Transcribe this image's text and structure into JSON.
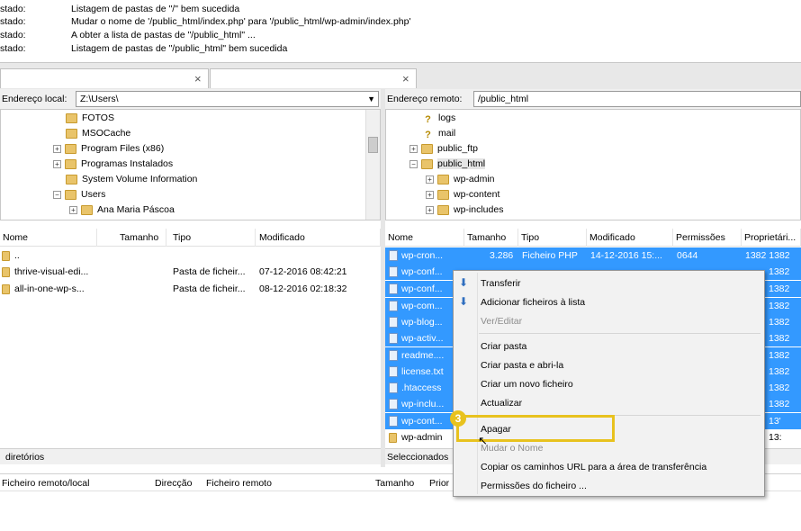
{
  "log": [
    {
      "label": "stado:",
      "message": "Listagem de pastas de \"/\" bem sucedida"
    },
    {
      "label": "stado:",
      "message": "Mudar o nome de '/public_html/index.php' para '/public_html/wp-admin/index.php'"
    },
    {
      "label": "stado:",
      "message": "A obter a lista de pastas de \"/public_html\" ..."
    },
    {
      "label": "stado:",
      "message": "Listagem de pastas de \"/public_html\" bem sucedida"
    }
  ],
  "tabs": {
    "close1": "×",
    "close2": "×"
  },
  "local": {
    "path_label": "Endereço local:",
    "path_value": "Z:\\Users\\",
    "tree": [
      "FOTOS",
      "MSOCache",
      "Program Files (x86)",
      "Programas Instalados",
      "System Volume Information",
      "Users",
      "Ana Maria Páscoa"
    ],
    "columns": [
      "Nome",
      "Tamanho",
      "Tipo",
      "Modificado"
    ],
    "files": [
      {
        "name": "..",
        "size": "",
        "type": "",
        "modified": ""
      },
      {
        "name": "thrive-visual-edi...",
        "size": "",
        "type": "Pasta de ficheir...",
        "modified": "07-12-2016 08:42:21"
      },
      {
        "name": "all-in-one-wp-s...",
        "size": "",
        "type": "Pasta de ficheir...",
        "modified": "08-12-2016 02:18:32"
      }
    ],
    "status": "diretórios"
  },
  "remote": {
    "path_label": "Endereço remoto:",
    "path_value": "/public_html",
    "tree": [
      "logs",
      "mail",
      "public_ftp",
      "public_html",
      "wp-admin",
      "wp-content",
      "wp-includes"
    ],
    "columns": [
      "Nome",
      "Tamanho",
      "Tipo",
      "Modificado",
      "Permissões",
      "Proprietári..."
    ],
    "files": [
      {
        "name": "wp-cron...",
        "size": "3.286",
        "type": "Ficheiro PHP",
        "modified": "14-12-2016 15:...",
        "perm": "0644",
        "owner": "1382 1382"
      },
      {
        "name": "wp-conf...",
        "size": "",
        "type": "",
        "modified": "",
        "perm": "",
        "owner": "1382"
      },
      {
        "name": "wp-conf...",
        "size": "",
        "type": "",
        "modified": "",
        "perm": "",
        "owner": "1382"
      },
      {
        "name": "wp-com...",
        "size": "",
        "type": "",
        "modified": "",
        "perm": "",
        "owner": "1382"
      },
      {
        "name": "wp-blog...",
        "size": "",
        "type": "",
        "modified": "",
        "perm": "",
        "owner": "1382"
      },
      {
        "name": "wp-activ...",
        "size": "",
        "type": "",
        "modified": "",
        "perm": "",
        "owner": "1382"
      },
      {
        "name": "readme....",
        "size": "",
        "type": "",
        "modified": "",
        "perm": "",
        "owner": "1382"
      },
      {
        "name": "license.txt",
        "size": "",
        "type": "",
        "modified": "",
        "perm": "",
        "owner": "1382"
      },
      {
        "name": ".htaccess",
        "size": "",
        "type": "",
        "modified": "",
        "perm": "",
        "owner": "1382"
      },
      {
        "name": "wp-inclu...",
        "size": "",
        "type": "",
        "modified": "",
        "perm": "",
        "owner": "1382"
      },
      {
        "name": "wp-cont...",
        "size": "",
        "type": "",
        "modified": "",
        "perm": "",
        "owner": "13'"
      },
      {
        "name": "wp-admin",
        "size": "",
        "type": "",
        "modified": "",
        "perm": "",
        "owner": "13:"
      }
    ],
    "status": "Seleccionados"
  },
  "context_menu": {
    "transfer": "Transferir",
    "add_queue": "Adicionar ficheiros à lista",
    "view_edit": "Ver/Editar",
    "create_dir": "Criar pasta",
    "create_dir_open": "Criar pasta e abri-la",
    "create_file": "Criar um novo ficheiro",
    "refresh": "Actualizar",
    "delete": "Apagar",
    "rename": "Mudar o Nome",
    "copy_url": "Copiar os caminhos URL para a área de transferência",
    "permissions": "Permissões do ficheiro ..."
  },
  "step_badge": "3",
  "queue": {
    "col_file": "Ficheiro remoto/local",
    "col_dir": "Direcção",
    "col_remote": "Ficheiro remoto",
    "col_size": "Tamanho",
    "col_prio": "Prior"
  },
  "colors": {
    "selection": "#3399ff",
    "highlight": "#e8c21e"
  }
}
